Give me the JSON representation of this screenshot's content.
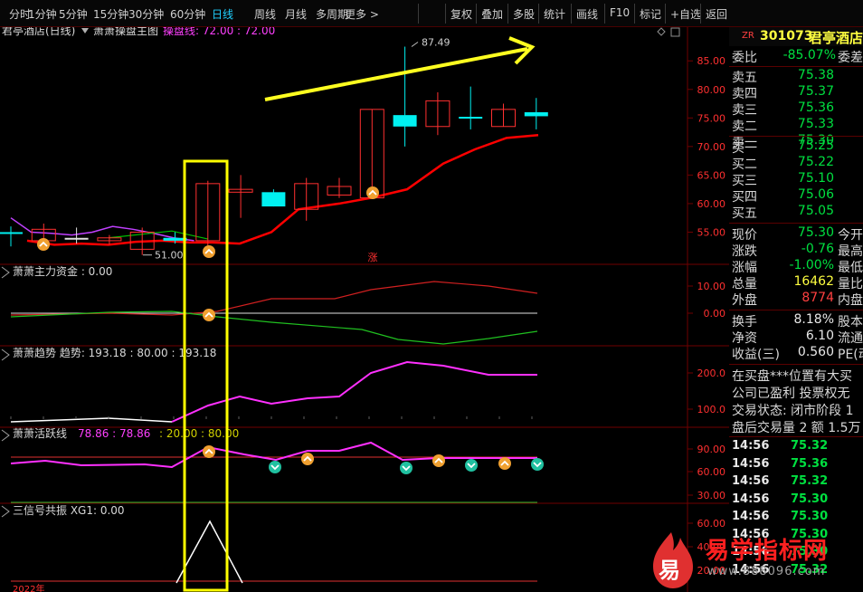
{
  "toolbar": {
    "left": [
      "分时",
      "1分钟",
      "5分钟",
      "15分钟",
      "30分钟",
      "60分钟",
      "日线",
      "周线",
      "月线",
      "多周期",
      "更多 >"
    ],
    "active": "日线",
    "right": [
      "复权",
      "叠加",
      "多股",
      "统计",
      "画线",
      "F10",
      "标记",
      "+自选",
      "返回"
    ]
  },
  "main_panel": {
    "stock_title": "君亭酒店(日线)",
    "indicator_name": "萧萧操盘主图",
    "indicator_line_label": "操盘线: 72.00 : 72.00",
    "high_label": "87.49",
    "low_label": "51.00",
    "badge": "涨",
    "y_ticks": [
      "85.00",
      "80.00",
      "75.00",
      "70.00",
      "65.00",
      "60.00",
      "55.00"
    ]
  },
  "panels": [
    {
      "name": "萧萧主力资金 : 0.00",
      "y_ticks": [
        "10.00",
        "0.00"
      ]
    },
    {
      "name": "萧萧趋势 趋势: 193.18 : 80.00 : 193.18",
      "y_ticks": [
        "200.0",
        "100.0"
      ]
    },
    {
      "name": "萧萧活跃线",
      "values": "78.86 : 78.86",
      "values2": ": 20.00 : 80.00",
      "y_ticks": [
        "90.00",
        "60.00",
        "30.00"
      ]
    },
    {
      "name": "三信号共振  XG1: 0.00",
      "y_ticks": [
        "60.00",
        "40.00",
        "20.00"
      ]
    }
  ],
  "bottom_label": "2022年",
  "quote": {
    "code_prefix": "ZR",
    "code": "301073",
    "name": "君亭酒店",
    "weibi_label": "委比",
    "weibi_value": "-85.07%",
    "weibi_extra": "委差",
    "asks": [
      {
        "label": "卖五",
        "price": "75.38"
      },
      {
        "label": "卖四",
        "price": "75.37"
      },
      {
        "label": "卖三",
        "price": "75.36"
      },
      {
        "label": "卖二",
        "price": "75.33"
      },
      {
        "label": "卖一",
        "price": "75.30"
      }
    ],
    "bids": [
      {
        "label": "买一",
        "price": "75.25"
      },
      {
        "label": "买二",
        "price": "75.22"
      },
      {
        "label": "买三",
        "price": "75.10"
      },
      {
        "label": "买四",
        "price": "75.06"
      },
      {
        "label": "买五",
        "price": "75.05"
      }
    ],
    "stats": [
      {
        "label": "现价",
        "value": "75.30",
        "extra": "今开",
        "color": "grn"
      },
      {
        "label": "涨跌",
        "value": "-0.76",
        "extra": "最高",
        "color": "grn"
      },
      {
        "label": "涨幅",
        "value": "-1.00%",
        "extra": "最低",
        "color": "grn"
      },
      {
        "label": "总量",
        "value": "16462",
        "extra": "量比",
        "color": "yel"
      },
      {
        "label": "外盘",
        "value": "8774",
        "extra": "内盘",
        "color": "red"
      }
    ],
    "stats2": [
      {
        "label": "换手",
        "value": "8.18%",
        "extra": "股本"
      },
      {
        "label": "净资",
        "value": "6.10",
        "extra": "流通"
      },
      {
        "label": "收益(三)",
        "value": "0.560",
        "extra": "PE(动"
      }
    ],
    "notes": [
      "在买盘***位置有大买",
      "公司已盈利 投票权无",
      "交易状态: 闭市阶段 1",
      "盘后交易量 2 额 1.5万"
    ],
    "ticks": [
      {
        "time": "14:56",
        "price": "75.32"
      },
      {
        "time": "14:56",
        "price": "75.36"
      },
      {
        "time": "14:56",
        "price": "75.32"
      },
      {
        "time": "14:56",
        "price": "75.30"
      },
      {
        "time": "14:56",
        "price": "75.30"
      },
      {
        "time": "14:56",
        "price": "75.30"
      },
      {
        "time": "14:56",
        "price": "75.30"
      },
      {
        "time": "14:56",
        "price": "75.32"
      }
    ]
  },
  "watermark": {
    "logo_char": "易",
    "title": "易学指标网",
    "url": "www.888096.com"
  },
  "chart_data": {
    "type": "candlestick",
    "candles": [
      {
        "open": 55.0,
        "close": 55.0,
        "high": 56.0,
        "low": 52.5,
        "color": "cyan"
      },
      {
        "open": 53.5,
        "close": 55.5,
        "high": 56.5,
        "low": 53.0,
        "color": "red"
      },
      {
        "open": 54.0,
        "close": 54.0,
        "high": 55.8,
        "low": 53.0,
        "color": "white"
      },
      {
        "open": 53.5,
        "close": 54.0,
        "high": 54.5,
        "low": 52.8,
        "color": "red"
      },
      {
        "open": 52.0,
        "close": 55.0,
        "high": 55.8,
        "low": 51.0,
        "color": "red"
      },
      {
        "open": 54.0,
        "close": 53.5,
        "high": 55.0,
        "low": 53.0,
        "color": "cyan"
      },
      {
        "open": 53.5,
        "close": 63.5,
        "high": 64.0,
        "low": 52.5,
        "color": "red"
      },
      {
        "open": 62.0,
        "close": 62.5,
        "high": 65.0,
        "low": 57.5,
        "color": "red"
      },
      {
        "open": 62.0,
        "close": 59.5,
        "high": 62.5,
        "low": 59.5,
        "color": "cyan"
      },
      {
        "open": 59.0,
        "close": 63.5,
        "high": 64.5,
        "low": 57.0,
        "color": "red"
      },
      {
        "open": 61.5,
        "close": 63.0,
        "high": 64.5,
        "low": 61.0,
        "color": "red"
      },
      {
        "open": 61.0,
        "close": 76.5,
        "high": 76.5,
        "low": 61.0,
        "color": "red"
      },
      {
        "open": 75.5,
        "close": 73.5,
        "high": 87.49,
        "low": 70.0,
        "color": "cyan"
      },
      {
        "open": 73.5,
        "close": 78.0,
        "high": 79.5,
        "low": 72.0,
        "color": "red"
      },
      {
        "open": 75.2,
        "close": 75.2,
        "high": 80.5,
        "low": 73.0,
        "color": "cyan"
      },
      {
        "open": 73.5,
        "close": 76.5,
        "high": 77.5,
        "low": 73.5,
        "color": "red"
      },
      {
        "open": 76.0,
        "close": 75.3,
        "high": 78.5,
        "low": 73.0,
        "color": "cyan"
      }
    ],
    "ma_line": [
      57.5,
      54.5,
      53.8,
      53.5,
      54.0,
      54.5,
      55.0,
      53.5,
      53.5,
      55.0,
      57.0,
      61.0,
      58.5,
      59.5,
      60.5,
      62.5,
      67.0,
      69.5,
      71.5,
      72.0
    ],
    "purple_line": [
      57.5,
      55.0,
      54.8,
      54.5,
      55.0,
      56.0,
      55.5,
      54.8,
      54.0,
      53.5
    ],
    "ylim": [
      50,
      89
    ]
  }
}
